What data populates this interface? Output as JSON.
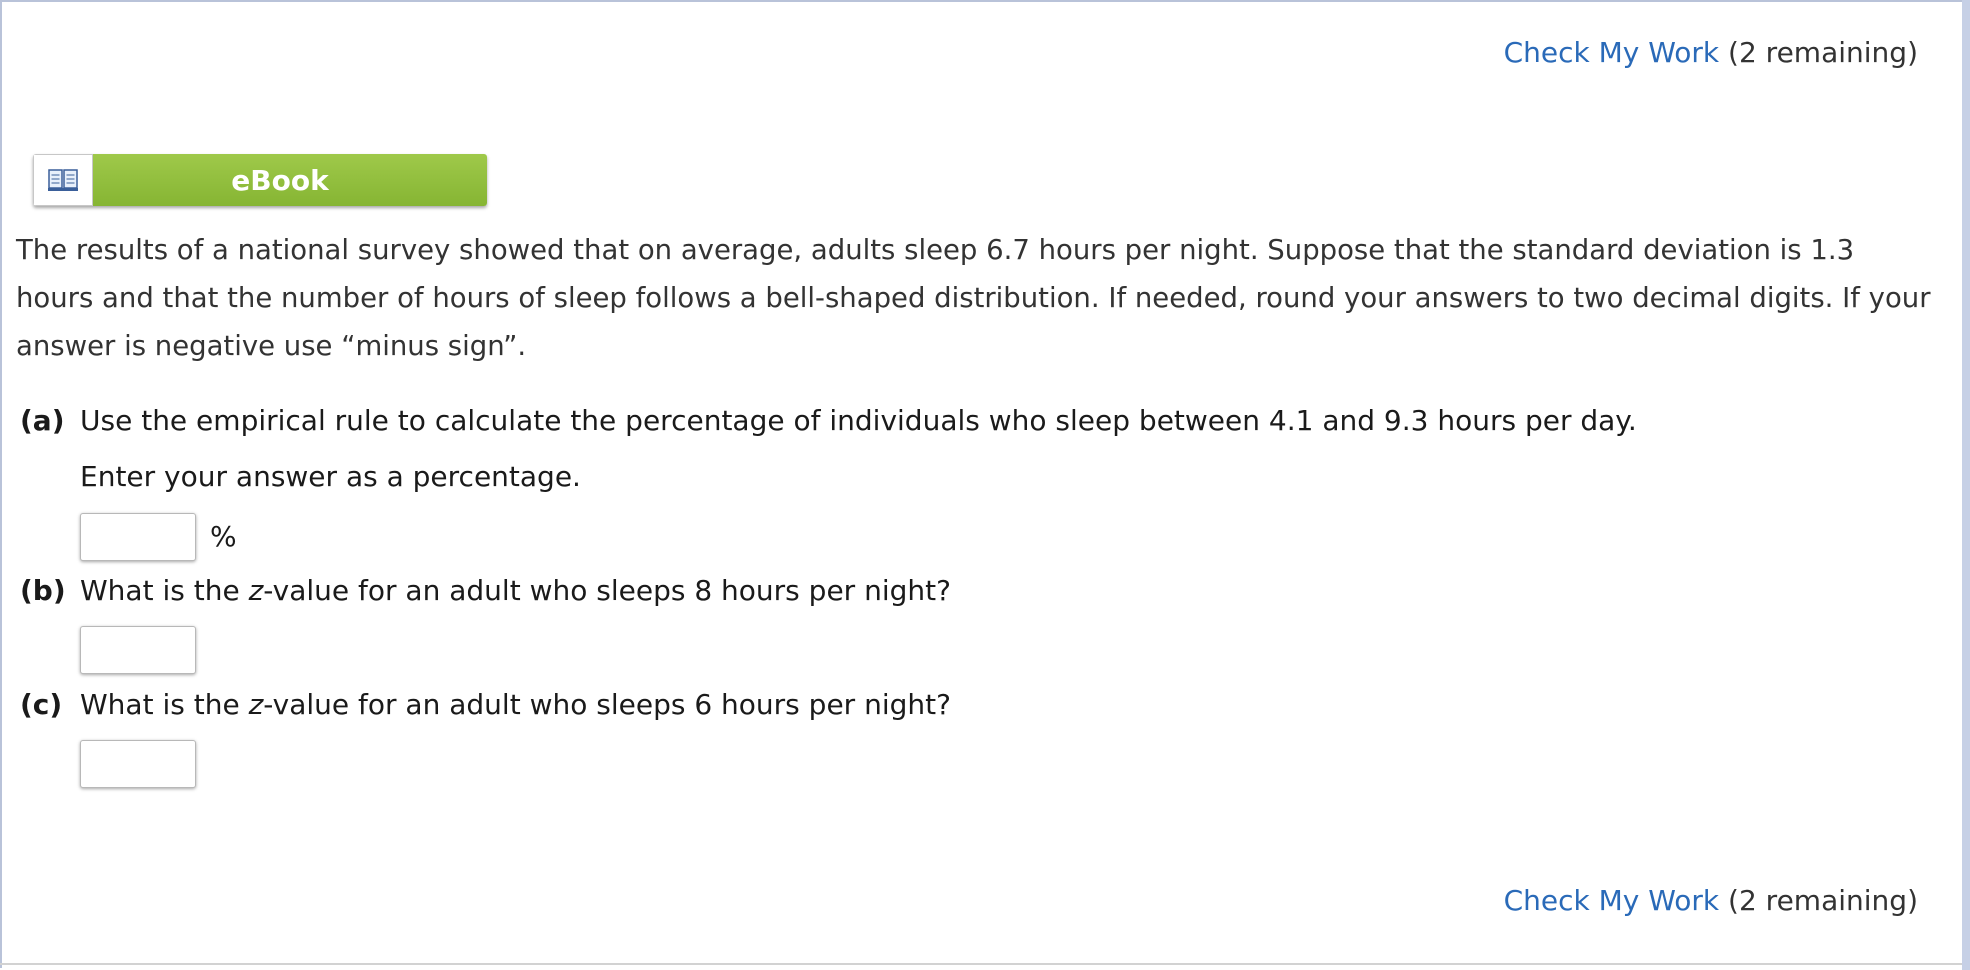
{
  "check_my_work": {
    "link_text": "Check My Work",
    "remaining_text": "(2 remaining)"
  },
  "ebook": {
    "label": "eBook",
    "icon": "open-book-icon"
  },
  "problem": {
    "statement": "The results of a national survey showed that on average, adults sleep 6.7 hours per night. Suppose that the standard deviation is 1.3 hours and that the number of hours of sleep follows a bell-shaped distribution. If needed, round your answers to two decimal digits. If your answer is negative use “minus sign”."
  },
  "parts": {
    "a": {
      "letter": "(a)",
      "question": "Use the empirical rule to calculate the percentage of individuals who sleep between 4.1 and 9.3 hours per day.",
      "instruction": "Enter your answer as a percentage.",
      "unit": "%",
      "value": ""
    },
    "b": {
      "letter": "(b)",
      "question_pre": "What is the ",
      "question_var": "z",
      "question_post": "-value for an adult who sleeps 8 hours per night?",
      "value": ""
    },
    "c": {
      "letter": "(c)",
      "question_pre": "What is the ",
      "question_var": "z",
      "question_post": "-value for an adult who sleeps 6 hours per night?",
      "value": ""
    }
  },
  "colors": {
    "link": "#2a6ab8",
    "ebook_green": "#8cbb3a",
    "frame_border": "#b9c3d9"
  }
}
